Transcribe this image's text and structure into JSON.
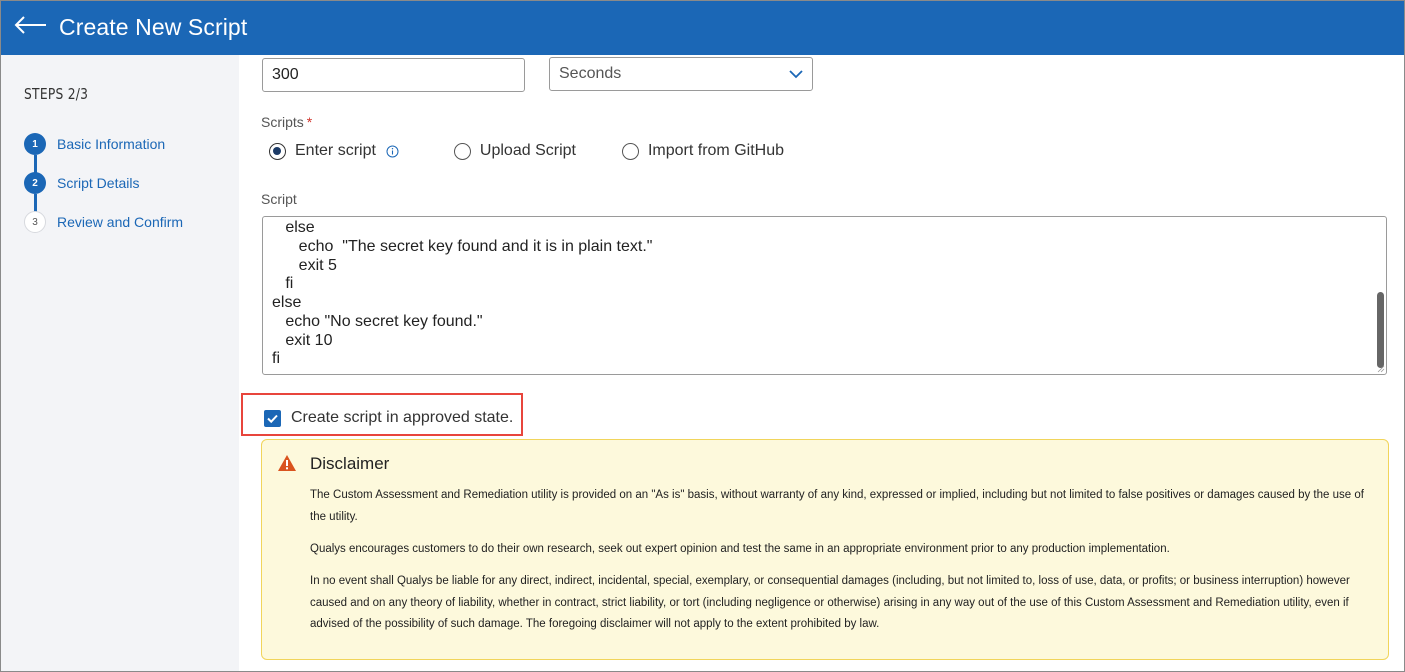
{
  "header": {
    "title": "Create New Script"
  },
  "sidebar": {
    "steps_label": "STEPS 2/3",
    "steps": [
      {
        "number": "1",
        "label": "Basic Information",
        "state": "done"
      },
      {
        "number": "2",
        "label": "Script Details",
        "state": "current"
      },
      {
        "number": "3",
        "label": "Review and Confirm",
        "state": "todo"
      }
    ]
  },
  "timeout": {
    "value": "300",
    "unit": "Seconds"
  },
  "scripts_field": {
    "label": "Scripts",
    "required_mark": "*",
    "options": [
      {
        "label": "Enter script",
        "selected": true
      },
      {
        "label": "Upload Script",
        "selected": false
      },
      {
        "label": "Import from GitHub",
        "selected": false
      }
    ]
  },
  "script_editor": {
    "label": "Script",
    "lines": [
      "   else",
      "      echo  \"The secret key found and it is in plain text.\"",
      "      exit 5",
      "   fi",
      "else",
      "   echo \"No secret key found.\"",
      "   exit 10",
      "fi"
    ]
  },
  "approve": {
    "label": "Create script in approved state.",
    "checked": true
  },
  "disclaimer": {
    "title": "Disclaimer",
    "p1": "The Custom Assessment and Remediation utility is provided on an \"As is\" basis, without warranty of any kind, expressed or implied, including but not limited to false positives or damages caused by the use of the utility.",
    "p2": "Qualys encourages customers to do their own research, seek out expert opinion and test the same in an appropriate environment prior to any production implementation.",
    "p3": "In no event shall Qualys be liable for any direct, indirect, incidental, special, exemplary, or consequential damages (including, but not limited to, loss of use, data, or profits; or business interruption) however caused and on any theory of liability, whether in contract, strict liability, or tort (including negligence or otherwise) arising in any way out of the use of this Custom Assessment and Remediation utility, even if advised of the possibility of such damage. The foregoing disclaimer will not apply to the extent prohibited by law."
  },
  "colors": {
    "header_bg": "#1b67b6",
    "accent": "#1b67b6",
    "highlight_border": "#e8453c",
    "disclaimer_bg": "#fdf9dc",
    "warning": "#d9531e"
  }
}
